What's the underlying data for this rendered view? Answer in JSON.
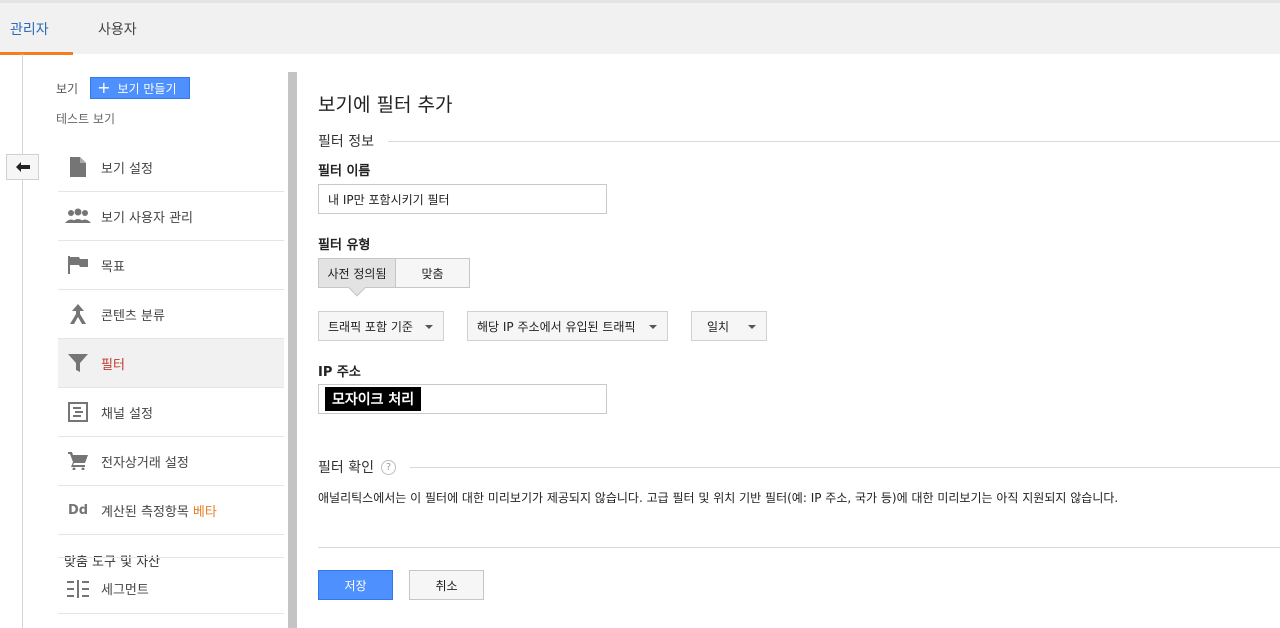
{
  "tabs": {
    "admin": "관리자",
    "user": "사용자"
  },
  "nav": {
    "view_label": "보기",
    "create_view": "보기 만들기",
    "test_view": "테스트 보기",
    "items": [
      {
        "label": "보기 설정",
        "icon": "document-icon"
      },
      {
        "label": "보기 사용자 관리",
        "icon": "users-icon"
      },
      {
        "label": "목표",
        "icon": "flag-icon"
      },
      {
        "label": "콘텐츠 분류",
        "icon": "content-grouping-icon"
      },
      {
        "label": "필터",
        "icon": "filter-icon",
        "active": true
      },
      {
        "label": "채널 설정",
        "icon": "channel-settings-icon"
      },
      {
        "label": "전자상거래 설정",
        "icon": "cart-icon"
      },
      {
        "label": "계산된 측정항목",
        "badge": "베타",
        "icon": "dd-icon"
      }
    ],
    "group_title": "맞춤 도구 및 자산",
    "group_items": [
      {
        "label": "세그먼트",
        "icon": "segment-icon"
      }
    ]
  },
  "main": {
    "title": "보기에 필터 추가",
    "filter_info": "필터 정보",
    "filter_name_label": "필터 이름",
    "filter_name_value": "내 IP만 포함시키기 필터",
    "filter_type_label": "필터 유형",
    "type_predefined": "사전 정의됨",
    "type_custom": "맞춤",
    "dropdown_include": "트래픽 포함 기준",
    "dropdown_source": "해당 IP 주소에서 유입된 트래픽",
    "dropdown_match": "일치",
    "ip_label": "IP 주소",
    "ip_value": "모자이크 처리",
    "verify_label": "필터 확인",
    "verify_help": "?",
    "verify_desc": "애널리틱스에서는 이 필터에 대한 미리보기가 제공되지 않습니다. 고급 필터 및 위치 기반 필터(예: IP 주소, 국가 등)에 대한 미리보기는 아직 지원되지 않습니다.",
    "save": "저장",
    "cancel": "취소"
  },
  "colors": {
    "accent": "#4d90fe",
    "active_text": "#c0392b",
    "tab_underline": "#f57c1f",
    "beta": "#e67e22"
  }
}
